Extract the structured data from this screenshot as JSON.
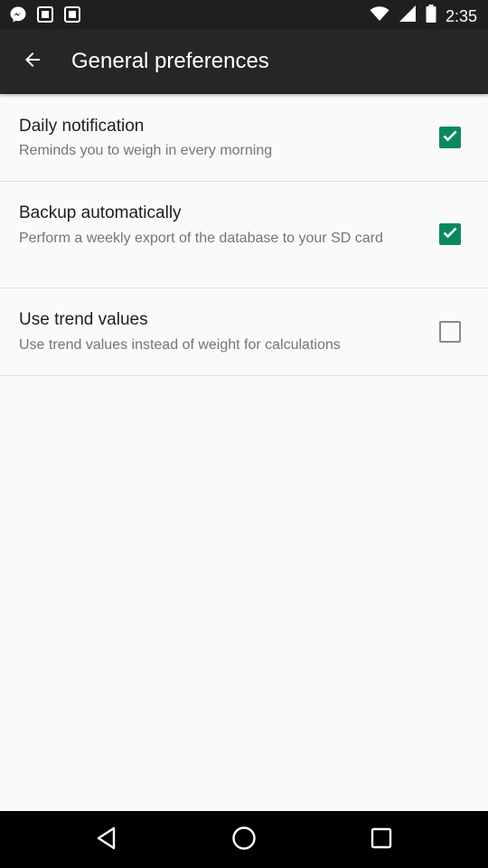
{
  "status_bar": {
    "time": "2:35",
    "left_icons": [
      "facebook-messenger-icon",
      "square-app-icon",
      "square-app-icon"
    ],
    "right_icons": [
      "wifi-icon",
      "signal-icon",
      "battery-icon"
    ]
  },
  "app_bar": {
    "title": "General preferences",
    "back_icon": "arrow-back-icon"
  },
  "preferences": [
    {
      "title": "Daily notification",
      "summary": "Reminds you to weigh in every morning",
      "checked": true
    },
    {
      "title": "Backup automatically",
      "summary": "Perform a weekly export of the database to your SD card",
      "checked": true
    },
    {
      "title": "Use trend values",
      "summary": "Use trend values instead of weight for calculations",
      "checked": false
    }
  ],
  "nav_bar": {
    "buttons": [
      "back-icon",
      "home-icon",
      "recents-icon"
    ]
  },
  "colors": {
    "status_bar": "#1f1f1f",
    "app_bar": "#262626",
    "background": "#fafafa",
    "accent": "#0a8a5c",
    "divider": "#dcdcdc",
    "nav_bar": "#000000"
  }
}
